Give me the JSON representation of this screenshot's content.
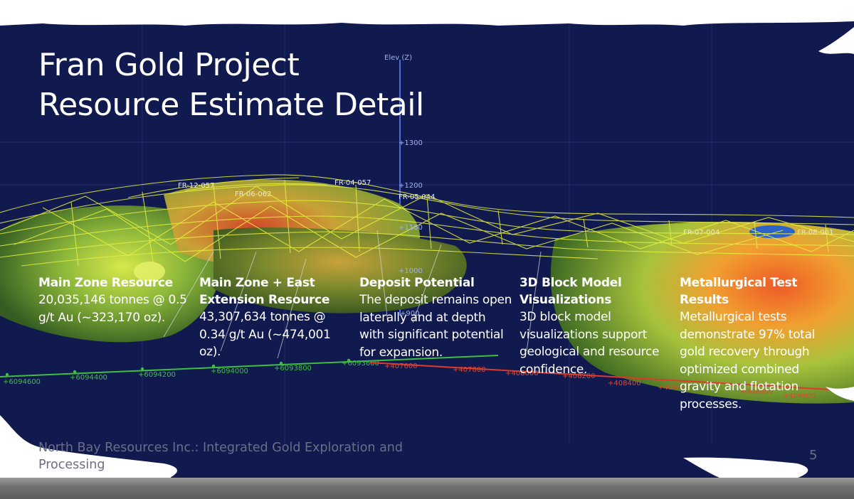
{
  "slide": {
    "title_line1": "Fran Gold Project",
    "title_line2": "Resource Estimate Detail",
    "columns": [
      {
        "heading": "Main Zone Resource",
        "body": "20,035,146 tonnes @ 0.5 g/t Au (~323,170 oz)."
      },
      {
        "heading": "Main Zone + East Extension Resource",
        "body": "43,307,634 tonnes @ 0.34 g/t Au (~474,001 oz)."
      },
      {
        "heading": "Deposit Potential",
        "body": "The deposit remains open laterally and at depth with significant potential for expansion."
      },
      {
        "heading": "3D Block Model Visualizations",
        "body": "3D block model visualizations support geological and resource confidence."
      },
      {
        "heading": "Metallurgical Test Results",
        "body": "Metallurgical tests demonstrate 97% total gold recovery through optimized combined gravity and flotation processes."
      }
    ],
    "footer": "North Bay Resources Inc.: Integrated Gold Exploration and Processing",
    "page_number": "5"
  },
  "model_view": {
    "elev_axis_label": "Elev (Z)",
    "elev_ticks": [
      "+1300",
      "+1200",
      "+1100",
      "+1000",
      "+900"
    ],
    "northing_ticks": [
      "+6094600",
      "+6094400",
      "+6094200",
      "+6094000",
      "+6093800",
      "+6093600"
    ],
    "easting_ticks": [
      "+407600",
      "+407800",
      "+408000",
      "+408200",
      "+408400",
      "+408600",
      "+408800",
      "+409000"
    ],
    "hole_labels": [
      "FR-05-044",
      "FR-06-062",
      "FR-04-057",
      "FR-12-057",
      "FR-07-004",
      "FR-08-001"
    ],
    "colors": {
      "background": "#101a4f",
      "wireframe": "#e8f040",
      "northing_axis": "#3fbf3f",
      "easting_axis": "#e03a2a",
      "elev_axis": "#4a6ce0"
    }
  }
}
